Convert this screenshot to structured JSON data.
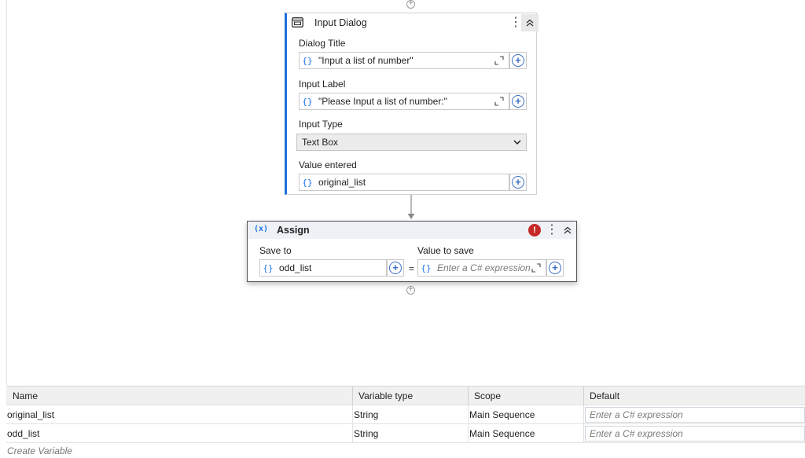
{
  "input_dialog": {
    "title": "Input Dialog",
    "dialog_title_label": "Dialog Title",
    "dialog_title_value": "\"Input a list of number\"",
    "input_label_label": "Input Label",
    "input_label_value": "\"Please Input a list of number:\"",
    "input_type_label": "Input Type",
    "input_type_value": "Text Box",
    "value_entered_label": "Value entered",
    "value_entered_value": "original_list"
  },
  "assign": {
    "title": "Assign",
    "save_to_label": "Save to",
    "save_to_value": "odd_list",
    "equals": "=",
    "value_to_save_label": "Value to save",
    "value_to_save_placeholder": "Enter a C# expression"
  },
  "variables": {
    "headers": [
      "Name",
      "Variable type",
      "Scope",
      "Default"
    ],
    "rows": [
      {
        "name": "original_list",
        "type": "String",
        "scope": "Main Sequence",
        "default": "Enter a C# expression"
      },
      {
        "name": "odd_list",
        "type": "String",
        "scope": "Main Sequence",
        "default": "Enter a C# expression"
      }
    ],
    "create_label": "Create Variable"
  },
  "icons": {
    "braces": "{}",
    "plus": "+",
    "kebab": "⋮",
    "error": "!",
    "assign_icon": "(x)"
  },
  "colors": {
    "accent_blue": "#1a73e8",
    "selection_bar": "#1e6fd9",
    "error_red": "#c62828"
  }
}
